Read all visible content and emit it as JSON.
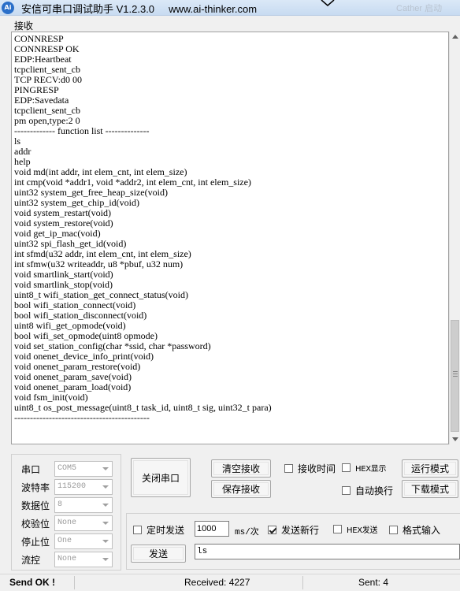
{
  "window": {
    "icon_label": "Ai",
    "title": "安信可串口调试助手 V1.2.3.0",
    "website": "www.ai-thinker.com",
    "ghost_text": "Cather 启动"
  },
  "receive": {
    "label": "接收",
    "lines": [
      "CONNRESP",
      "CONNRESP OK",
      "EDP:Heartbeat",
      "tcpclient_sent_cb",
      "TCP RECV:d0 00",
      "PINGRESP",
      "EDP:Savedata",
      "tcpclient_sent_cb",
      "pm open,type:2 0",
      "------------- function list --------------",
      "ls",
      "addr",
      "help",
      "void md(int addr, int elem_cnt, int elem_size)",
      "int cmp(void *addr1, void *addr2, int elem_cnt, int elem_size)",
      "uint32 system_get_free_heap_size(void)",
      "uint32 system_get_chip_id(void)",
      "void system_restart(void)",
      "void system_restore(void)",
      "void get_ip_mac(void)",
      "uint32 spi_flash_get_id(void)",
      "int sfmd(u32 addr, int elem_cnt, int elem_size)",
      "int sfmw(u32 writeaddr, u8 *pbuf, u32 num)",
      "void smartlink_start(void)",
      "void smartlink_stop(void)",
      "uint8_t wifi_station_get_connect_status(void)",
      "bool wifi_station_connect(void)",
      "bool wifi_station_disconnect(void)",
      "uint8 wifi_get_opmode(void)",
      "bool wifi_set_opmode(uint8 opmode)",
      "void set_station_config(char *ssid, char *password)",
      "void onenet_device_info_print(void)",
      "void onenet_param_restore(void)",
      "void onenet_param_save(void)",
      "void onenet_param_load(void)",
      "void fsm_init(void)",
      "uint8_t os_post_message(uint8_t task_id, uint8_t sig, uint32_t para)",
      "-------------------------------------------"
    ]
  },
  "settings": {
    "port": {
      "label": "串口",
      "value": "COM5"
    },
    "baud": {
      "label": "波特率",
      "value": "115200"
    },
    "databits": {
      "label": "数据位",
      "value": "8"
    },
    "parity": {
      "label": "校验位",
      "value": "None"
    },
    "stopbits": {
      "label": "停止位",
      "value": "One"
    },
    "flow": {
      "label": "流控",
      "value": "None"
    }
  },
  "buttons": {
    "close_port": "关闭串口",
    "clear_recv": "清空接收",
    "save_recv": "保存接收",
    "run_mode": "运行模式",
    "download_mode": "下载模式",
    "send": "发送"
  },
  "options": {
    "recv_time": {
      "label": "接收时间",
      "checked": false
    },
    "hex_display": {
      "label": "HEX显示",
      "checked": false
    },
    "auto_wrap": {
      "label": "自动换行",
      "checked": false
    },
    "timed_send": {
      "label": "定时发送",
      "checked": false
    },
    "send_newline": {
      "label": "发送新行",
      "checked": true
    },
    "hex_send": {
      "label": "HEX发送",
      "checked": false
    },
    "format_input": {
      "label": "格式输入",
      "checked": false
    }
  },
  "send": {
    "period_value": "1000",
    "period_unit": "ms/次",
    "input_value": "ls"
  },
  "status": {
    "message": "Send OK !",
    "received_label": "Received: 4227",
    "sent_label": "Sent: 4"
  }
}
